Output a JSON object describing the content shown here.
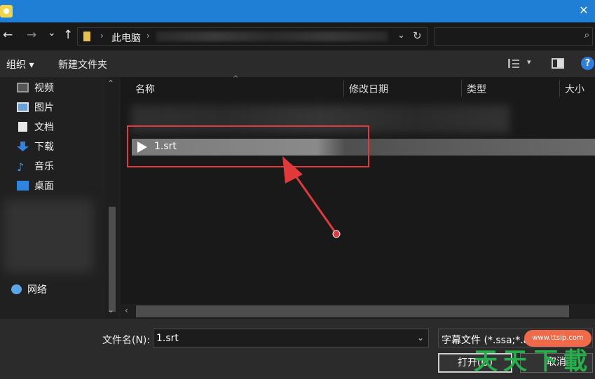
{
  "titlebar": {
    "close_glyph": "✕"
  },
  "nav": {
    "back": "←",
    "forward": "→",
    "history_dd": "⌄",
    "up": "↑",
    "breadcrumb": "此电脑",
    "breadcrumb_sep": "›",
    "dropdown": "⌄",
    "refresh": "↻",
    "search_icon": "⌕"
  },
  "toolbar": {
    "organize": "组织 ▾",
    "new_folder": "新建文件夹",
    "view_dd": "▾",
    "help": "?"
  },
  "sidebar": {
    "items": [
      {
        "label": "视频",
        "icon": "video-icon"
      },
      {
        "label": "图片",
        "icon": "picture-icon"
      },
      {
        "label": "文档",
        "icon": "document-icon"
      },
      {
        "label": "下载",
        "icon": "download-icon"
      },
      {
        "label": "音乐",
        "icon": "music-icon"
      },
      {
        "label": "桌面",
        "icon": "desktop-icon"
      }
    ],
    "network": "网络",
    "scroll_up": "⌃",
    "scroll_down": "⌄"
  },
  "columns": {
    "name": "名称",
    "modified": "修改日期",
    "type": "类型",
    "size": "大小"
  },
  "files": [
    {
      "name": "1.srt",
      "selected": true
    }
  ],
  "hscroll": {
    "left": "‹"
  },
  "footer": {
    "filename_label": "文件名(N):",
    "filename_value": "1.srt",
    "filename_dd": "⌄",
    "filetype_value": "字幕文件 (*.ssa;*.ass;*.srt)",
    "open": "打开(O)",
    "cancel": "取消"
  },
  "watermark": {
    "url": "www.ttsip.com",
    "chars": [
      "天",
      "天",
      "下",
      "載"
    ]
  },
  "colors": {
    "titlebar": "#1f7fd4",
    "highlight": "#e23a3a",
    "watermark_green": "#24b04a",
    "watermark_orange": "#f06a4a"
  }
}
